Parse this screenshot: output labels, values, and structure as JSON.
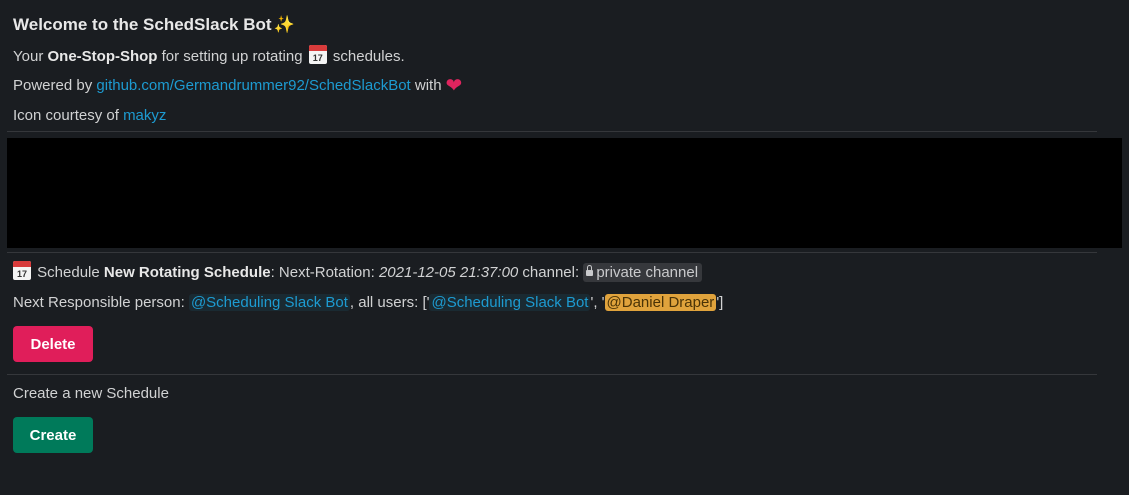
{
  "header": {
    "title": "Welcome to the SchedSlack Bot",
    "title_emoji": "party-popper-icon"
  },
  "intro": {
    "prefix": "Your ",
    "bold": "One-Stop-Shop",
    "middle": " for setting up rotating ",
    "calendar_day": "17",
    "suffix": " schedules."
  },
  "powered": {
    "prefix": "Powered by ",
    "link": "github.com/Germandrummer92/SchedSlackBot",
    "suffix": " with"
  },
  "icon_credit": {
    "prefix": "Icon courtesy of ",
    "link": "makyz"
  },
  "schedule": {
    "calendar_day": "17",
    "label": " Schedule ",
    "name": "New Rotating Schedule",
    "next_rotation_label": ": Next-Rotation: ",
    "next_rotation_value": "2021-12-05 21:37:00",
    "channel_label": " channel: ",
    "channel_value": "private channel",
    "responsible_label": "Next Responsible person: ",
    "responsible_mention": "@Scheduling Slack Bot",
    "all_users_label": ", all users: ['",
    "user1": "@Scheduling Slack Bot",
    "sep": "', '",
    "user2": "@Daniel Draper",
    "close": "']",
    "delete_label": "Delete"
  },
  "create": {
    "text": "Create a new Schedule",
    "button_label": "Create"
  },
  "colors": {
    "background": "#1a1d21",
    "link": "#1d9bd1",
    "danger": "#e01e5a",
    "primary": "#007a5a",
    "highlight_mention": "#e0a33c"
  }
}
